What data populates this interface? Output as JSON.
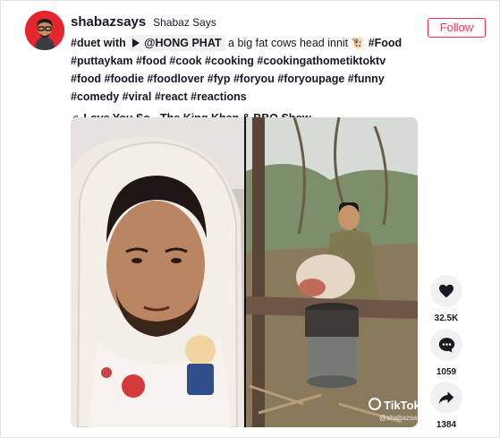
{
  "author": {
    "username": "shabazsays",
    "nickname": "Shabaz Says"
  },
  "follow_label": "Follow",
  "caption": {
    "part1": "#duet with",
    "mention": "@HONG PHAT",
    "part2": "a big fat cows head innit 🐮",
    "tag_food": "#Food",
    "line2": "#puttaykam #food #cook #cooking #cookingathometiktoktv #food",
    "line3": "#foodie #foodlover #fyp #foryou #foryoupage #funny #comedy #viral",
    "line4": "#react #reactions"
  },
  "music": {
    "note": "♫",
    "title": "Love You So - The King Khan & BBQ Show"
  },
  "video": {
    "watermark_brand": "TikTok",
    "watermark_handle": "@shabazsays"
  },
  "actions": {
    "likes": "32.5K",
    "comments": "1059",
    "shares": "1384"
  },
  "colors": {
    "accent": "#fe2c55",
    "avatar_bg": "#e5262d",
    "action_bg": "#f1f1f2"
  }
}
